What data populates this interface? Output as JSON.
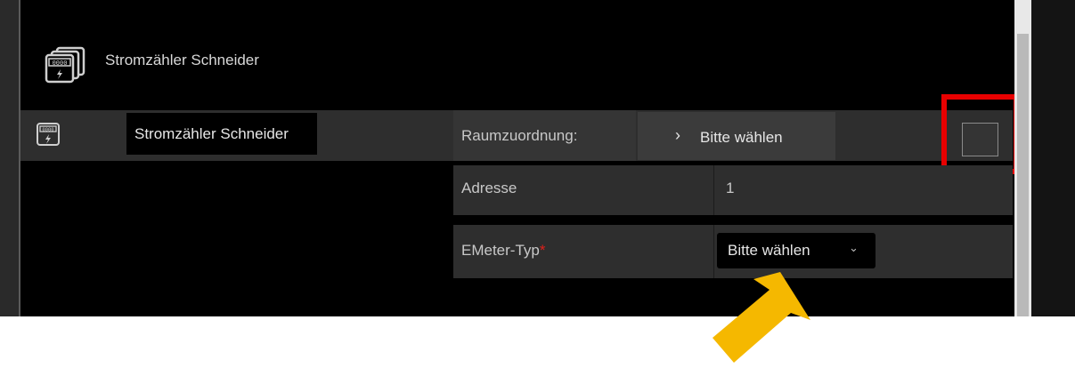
{
  "header": {
    "title": "Stromzähler Schneider",
    "icon": "meter-stack-icon"
  },
  "device_row": {
    "name": "Stromzähler Schneider",
    "icon": "meter-icon"
  },
  "fields": {
    "room_label": "Raumzuordnung:",
    "room_value": "Bitte wählen",
    "address_label": "Adresse",
    "address_value": "1",
    "emeter_label": "EMeter-Typ",
    "emeter_required": "*",
    "emeter_value": "Bitte wählen"
  },
  "colors": {
    "highlight": "#e80000",
    "arrow": "#f5b800",
    "required": "#e0201a"
  }
}
